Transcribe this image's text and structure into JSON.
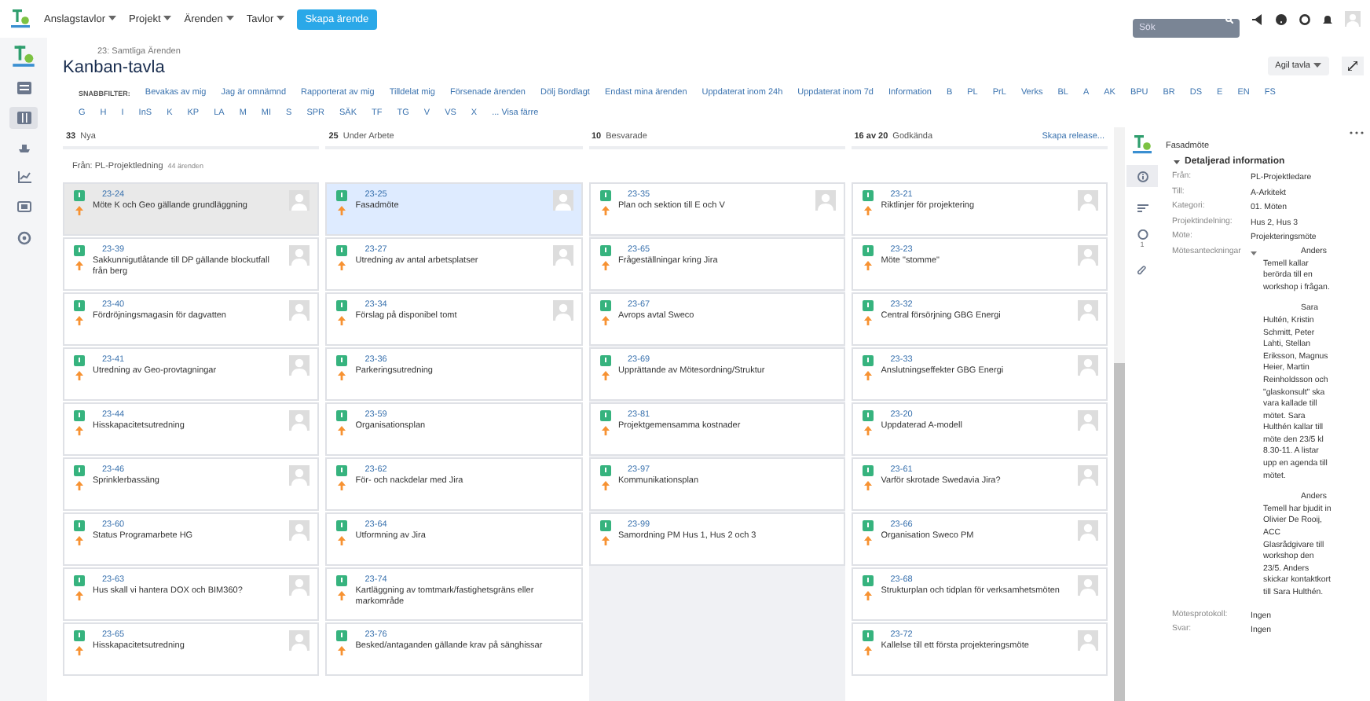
{
  "top_bar": {
    "menus": [
      {
        "label": "Anslagstavlor"
      },
      {
        "label": "Projekt"
      },
      {
        "label": "Ärenden"
      },
      {
        "label": "Tavlor"
      }
    ],
    "create_button": "Skapa ärende",
    "search": {
      "placeholder": "Sök"
    }
  },
  "sidebar": {
    "items": [
      {
        "kind": "backlog",
        "selected": false
      },
      {
        "kind": "board",
        "selected": true
      },
      {
        "kind": "releases",
        "selected": false
      },
      {
        "kind": "reports",
        "selected": false
      },
      {
        "kind": "issues",
        "selected": false
      },
      {
        "kind": "components",
        "selected": false
      }
    ]
  },
  "header": {
    "breadcrumb": "23: Samtliga Ärenden",
    "title": "Kanban-tavla",
    "board_button": "Agil tavla"
  },
  "quick_filters": {
    "label": "SNABBFILTER:",
    "items": [
      "Bevakas av mig",
      "Jag är omnämnd",
      "Rapporterat av mig",
      "Tilldelat mig",
      "Försenade ärenden",
      "Dölj Bordlagt",
      "Endast mina ärenden",
      "Uppdaterat inom 24h",
      "Uppdaterat inom 7d",
      "Information",
      "B",
      "PL",
      "PrL",
      "Verks",
      "BL",
      "A",
      "AK",
      "BPU",
      "BR",
      "DS",
      "E",
      "EN",
      "FS",
      "G",
      "H",
      "I",
      "InS",
      "K",
      "KP",
      "LA",
      "M",
      "MI",
      "S",
      "SPR",
      "SÄK",
      "TF",
      "TG",
      "V",
      "VS",
      "X",
      "... Visa färre"
    ]
  },
  "board": {
    "columns": [
      {
        "count": "33",
        "name": "Nya",
        "cards": [
          {
            "key": "23-24",
            "summary": "Möte K och Geo gällande grundläggning",
            "avatar": true,
            "selected": false,
            "hovered": true
          },
          {
            "key": "23-39",
            "summary": "Sakkunnigutlåtande till DP gällande blockutfall från berg",
            "avatar": true,
            "selected": false,
            "hovered": false
          },
          {
            "key": "23-40",
            "summary": "Fördröjningsmagasin för dagvatten",
            "avatar": true,
            "selected": false,
            "hovered": false
          },
          {
            "key": "23-41",
            "summary": "Utredning av Geo-provtagningar",
            "avatar": true,
            "selected": false,
            "hovered": false
          },
          {
            "key": "23-44",
            "summary": "Hisskapacitetsutredning",
            "avatar": true,
            "selected": false,
            "hovered": false
          },
          {
            "key": "23-46",
            "summary": "Sprinklerbassäng",
            "avatar": true,
            "selected": false,
            "hovered": false
          },
          {
            "key": "23-60",
            "summary": "Status Programarbete HG",
            "avatar": true,
            "selected": false,
            "hovered": false
          },
          {
            "key": "23-63",
            "summary": "Hus skall vi hantera DOX och BIM360?",
            "avatar": true,
            "selected": false,
            "hovered": false
          },
          {
            "key": "23-65",
            "summary": "Hisskapacitetsutredning",
            "avatar": true,
            "selected": false,
            "hovered": false
          }
        ]
      },
      {
        "count": "25",
        "name": "Under Arbete",
        "cards": [
          {
            "key": "23-25",
            "summary": "Fasadmöte",
            "avatar": true,
            "selected": true,
            "hovered": false
          },
          {
            "key": "23-27",
            "summary": "Utredning av antal arbetsplatser",
            "avatar": true,
            "selected": false,
            "hovered": false
          },
          {
            "key": "23-34",
            "summary": "Förslag på disponibel tomt",
            "avatar": true,
            "selected": false,
            "hovered": false
          },
          {
            "key": "23-36",
            "summary": "Parkeringsutredning",
            "avatar": false,
            "selected": false,
            "hovered": false
          },
          {
            "key": "23-59",
            "summary": "Organisationsplan",
            "avatar": false,
            "selected": false,
            "hovered": false
          },
          {
            "key": "23-62",
            "summary": "För- och nackdelar med Jira",
            "avatar": false,
            "selected": false,
            "hovered": false
          },
          {
            "key": "23-64",
            "summary": "Utformning av Jira",
            "avatar": false,
            "selected": false,
            "hovered": false
          },
          {
            "key": "23-74",
            "summary": "Kartläggning av tomtmark/fastighetsgräns eller markområde",
            "avatar": false,
            "selected": false,
            "hovered": false
          },
          {
            "key": "23-76",
            "summary": "Besked/antaganden gällande krav på sänghissar",
            "avatar": false,
            "selected": false,
            "hovered": false
          }
        ]
      },
      {
        "count": "10",
        "name": "Besvarade",
        "cards": [
          {
            "key": "23-35",
            "summary": "Plan och sektion till E och V",
            "avatar": true,
            "selected": false,
            "hovered": false
          },
          {
            "key": "23-65",
            "summary": "Frågeställningar kring Jira",
            "avatar": false,
            "selected": false,
            "hovered": false
          },
          {
            "key": "23-67",
            "summary": "Avrops avtal Sweco",
            "avatar": false,
            "selected": false,
            "hovered": false
          },
          {
            "key": "23-69",
            "summary": "Upprättande av Mötesordning/Struktur",
            "avatar": false,
            "selected": false,
            "hovered": false
          },
          {
            "key": "23-81",
            "summary": "Projektgemensamma kostnader",
            "avatar": false,
            "selected": false,
            "hovered": false
          },
          {
            "key": "23-97",
            "summary": "Kommunikationsplan",
            "avatar": false,
            "selected": false,
            "hovered": false
          },
          {
            "key": "23-99",
            "summary": "Samordning PM Hus 1, Hus 2 och 3",
            "avatar": false,
            "selected": false,
            "hovered": false
          }
        ]
      },
      {
        "count": "16 av 20",
        "name": "Godkända",
        "action": "Skapa release...",
        "cards": [
          {
            "key": "23-21",
            "summary": "Riktlinjer för projektering",
            "avatar": true,
            "selected": false,
            "hovered": false
          },
          {
            "key": "23-23",
            "summary": "Möte \"stomme\"",
            "avatar": true,
            "selected": false,
            "hovered": false
          },
          {
            "key": "23-32",
            "summary": "Central försörjning GBG Energi",
            "avatar": true,
            "selected": false,
            "hovered": false
          },
          {
            "key": "23-33",
            "summary": "Anslutningseffekter GBG Energi",
            "avatar": true,
            "selected": false,
            "hovered": false
          },
          {
            "key": "23-20",
            "summary": "Uppdaterad A-modell",
            "avatar": true,
            "selected": false,
            "hovered": false
          },
          {
            "key": "23-61",
            "summary": "Varför skrotade Swedavia Jira?",
            "avatar": true,
            "selected": false,
            "hovered": false
          },
          {
            "key": "23-66",
            "summary": "Organisation Sweco PM",
            "avatar": true,
            "selected": false,
            "hovered": false
          },
          {
            "key": "23-68",
            "summary": "Strukturplan och tidplan för verksamhetsmöten",
            "avatar": true,
            "selected": false,
            "hovered": false
          },
          {
            "key": "23-72",
            "summary": "Kallelse till ett första projekteringsmöte",
            "avatar": true,
            "selected": false,
            "hovered": false
          }
        ]
      }
    ],
    "swimlane": {
      "name": "Från: PL-Projektledning",
      "count": "44 ärenden"
    }
  },
  "detail": {
    "title": "Fasadmöte",
    "tabs": [
      {
        "kind": "info",
        "selected": true
      },
      {
        "kind": "description",
        "selected": false
      },
      {
        "kind": "comments",
        "selected": false,
        "count": "1"
      },
      {
        "kind": "attachments",
        "selected": false
      }
    ],
    "section": {
      "title": "Detaljerad information",
      "expanded": true
    },
    "fields": [
      {
        "label": "Från:",
        "value": "PL-Projektledare"
      },
      {
        "label": "Till:",
        "value": "A-Arkitekt"
      },
      {
        "label": "Kategori:",
        "value": "01. Möten"
      },
      {
        "label": "Projektindelning:",
        "value": "Hus 2, Hus 3"
      },
      {
        "label": "Möte:",
        "value": "Projekteringsmöte"
      }
    ],
    "notes": {
      "label": "Mötesanteckningar",
      "paragraphs": [
        "Anders Temell kallar berörda till en workshop i frågan.",
        "Sara Hultén, Kristin Schmitt, Peter Lahti, Stellan Eriksson, Magnus Heier, Martin Reinholdsson och \"glaskonsult\" ska vara kallade till mötet. Sara Hulthén kallar till möte den 23/5 kl 8.30-11. A listar upp en agenda till mötet.",
        "Anders Temell har bjudit in Olivier De Rooij, ACC Glasrådgivare till workshop den 23/5. Anders skickar kontaktkort till Sara Hulthén."
      ]
    },
    "fields_after": [
      {
        "label": "Mötesprotokoll:",
        "value": "Ingen"
      },
      {
        "label": "Svar:",
        "value": "Ingen"
      }
    ]
  }
}
